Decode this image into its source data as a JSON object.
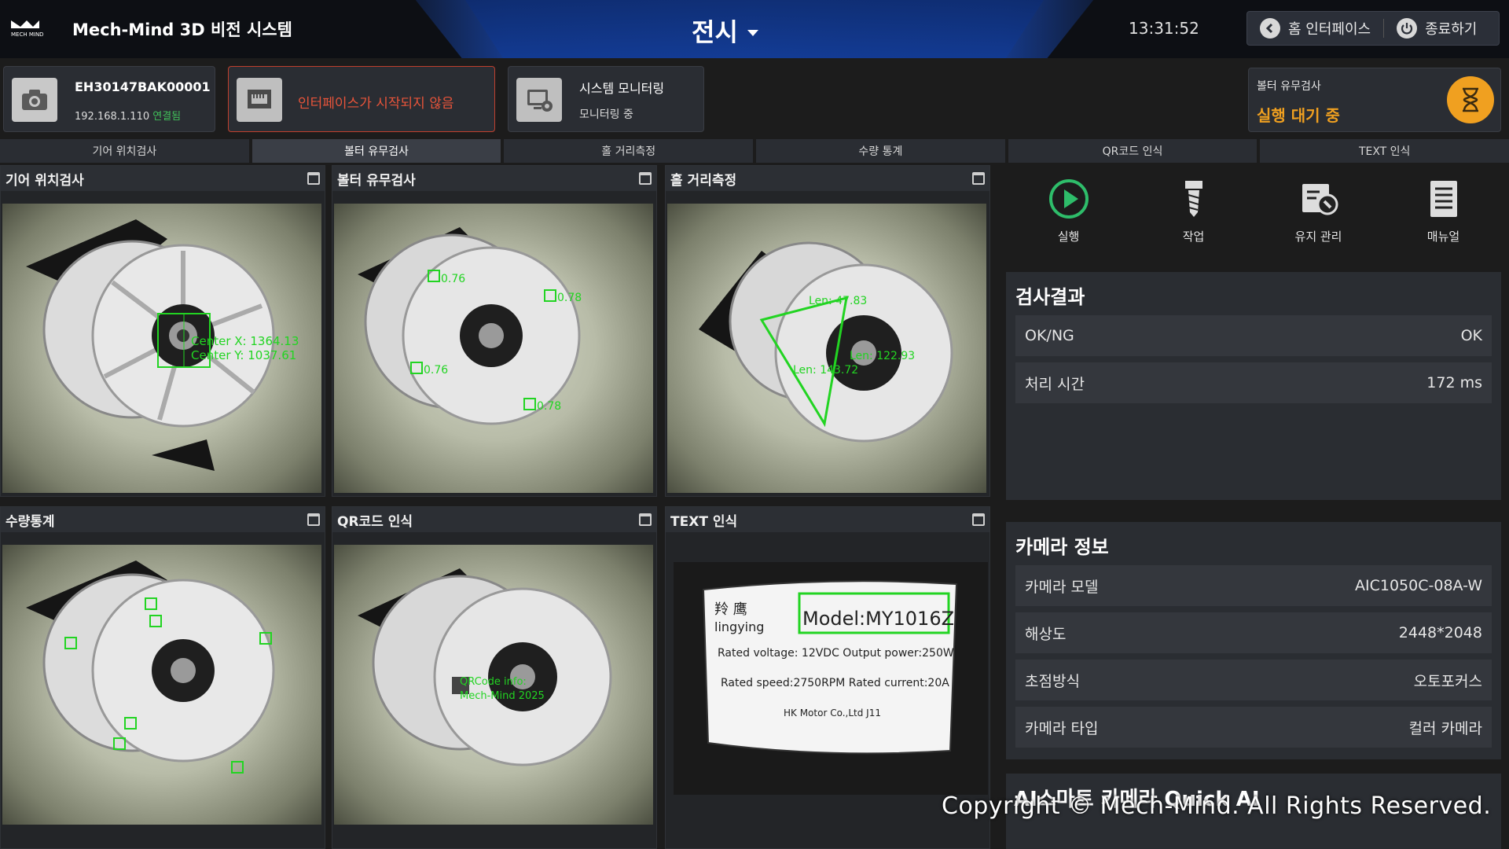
{
  "header": {
    "app_title": "Mech-Mind 3D 비전 시스템",
    "logo_text": "MECH MIND",
    "mode": "전시",
    "clock": "13:31:52",
    "home_label": "홈 인터페이스",
    "exit_label": "종료하기"
  },
  "status": {
    "camera_id": "EH30147BAK00001",
    "camera_ip": "192.168.1.110",
    "camera_conn": "연결됨",
    "interface_msg": "인터페이스가 시작되지 않음",
    "monitor_title": "시스템 모니터링",
    "monitor_sub": "모니터링 중",
    "current_task": "볼터 유무검사",
    "run_state": "실행 대기 중"
  },
  "tabs": [
    "기어 위치검사",
    "볼터 유무검사",
    "홀 거리측정",
    "수량 통계",
    "QR코드 인식",
    "TEXT 인식"
  ],
  "active_tab": 1,
  "panels": {
    "p1": {
      "title": "기어 위치검사",
      "overlay": "Center X: 1364.13",
      "overlay2": "Center Y: 1037.61"
    },
    "p2": {
      "title": "볼터 유무검사",
      "ok1": "0.76",
      "ok2": "0.78",
      "ok3": "0.76",
      "ok4": "0.78"
    },
    "p3": {
      "title": "홀 거리측정",
      "m1": "Len: 47.83",
      "m2": "Len: 122.93",
      "m3": "Len: 143.72"
    },
    "p4": {
      "title": "수량통계"
    },
    "p5": {
      "title": "QR코드 인식",
      "qr1": "QRCode info:",
      "qr2": "Mech-Mind 2025"
    },
    "p6": {
      "title": "TEXT 인식",
      "brand": "羚 鹰",
      "brand_en": "lingying",
      "model": "Model:MY1016Z",
      "line1": "Rated voltage: 12VDC   Output power:250W",
      "line2": "Rated speed:2750RPM   Rated current:20A",
      "line3": "HK Motor Co.,Ltd    J11"
    }
  },
  "actions": {
    "run": "실행",
    "job": "작업",
    "maintain": "유지 관리",
    "manual": "매뉴얼"
  },
  "result": {
    "title": "검사결과",
    "rows": [
      {
        "label": "OK/NG",
        "value": "OK"
      },
      {
        "label": "처리 시간",
        "value": "172 ms"
      }
    ]
  },
  "camera": {
    "title": "카메라 정보",
    "rows": [
      {
        "label": "카메라 모델",
        "value": "AIC1050C-08A-W"
      },
      {
        "label": "해상도",
        "value": "2448*2048"
      },
      {
        "label": "초점방식",
        "value": "오토포커스"
      },
      {
        "label": "카메라 타입",
        "value": "컬러 카메라"
      }
    ]
  },
  "quickai": "AI스마트 카메라 Quick AI",
  "copyright": "Copyright © Mech-Mind. All Rights Reserved.",
  "colors": {
    "accent_ok": "#41c05a",
    "warning": "#f0a020",
    "error": "#e8543a",
    "detect_green": "#22d422"
  }
}
